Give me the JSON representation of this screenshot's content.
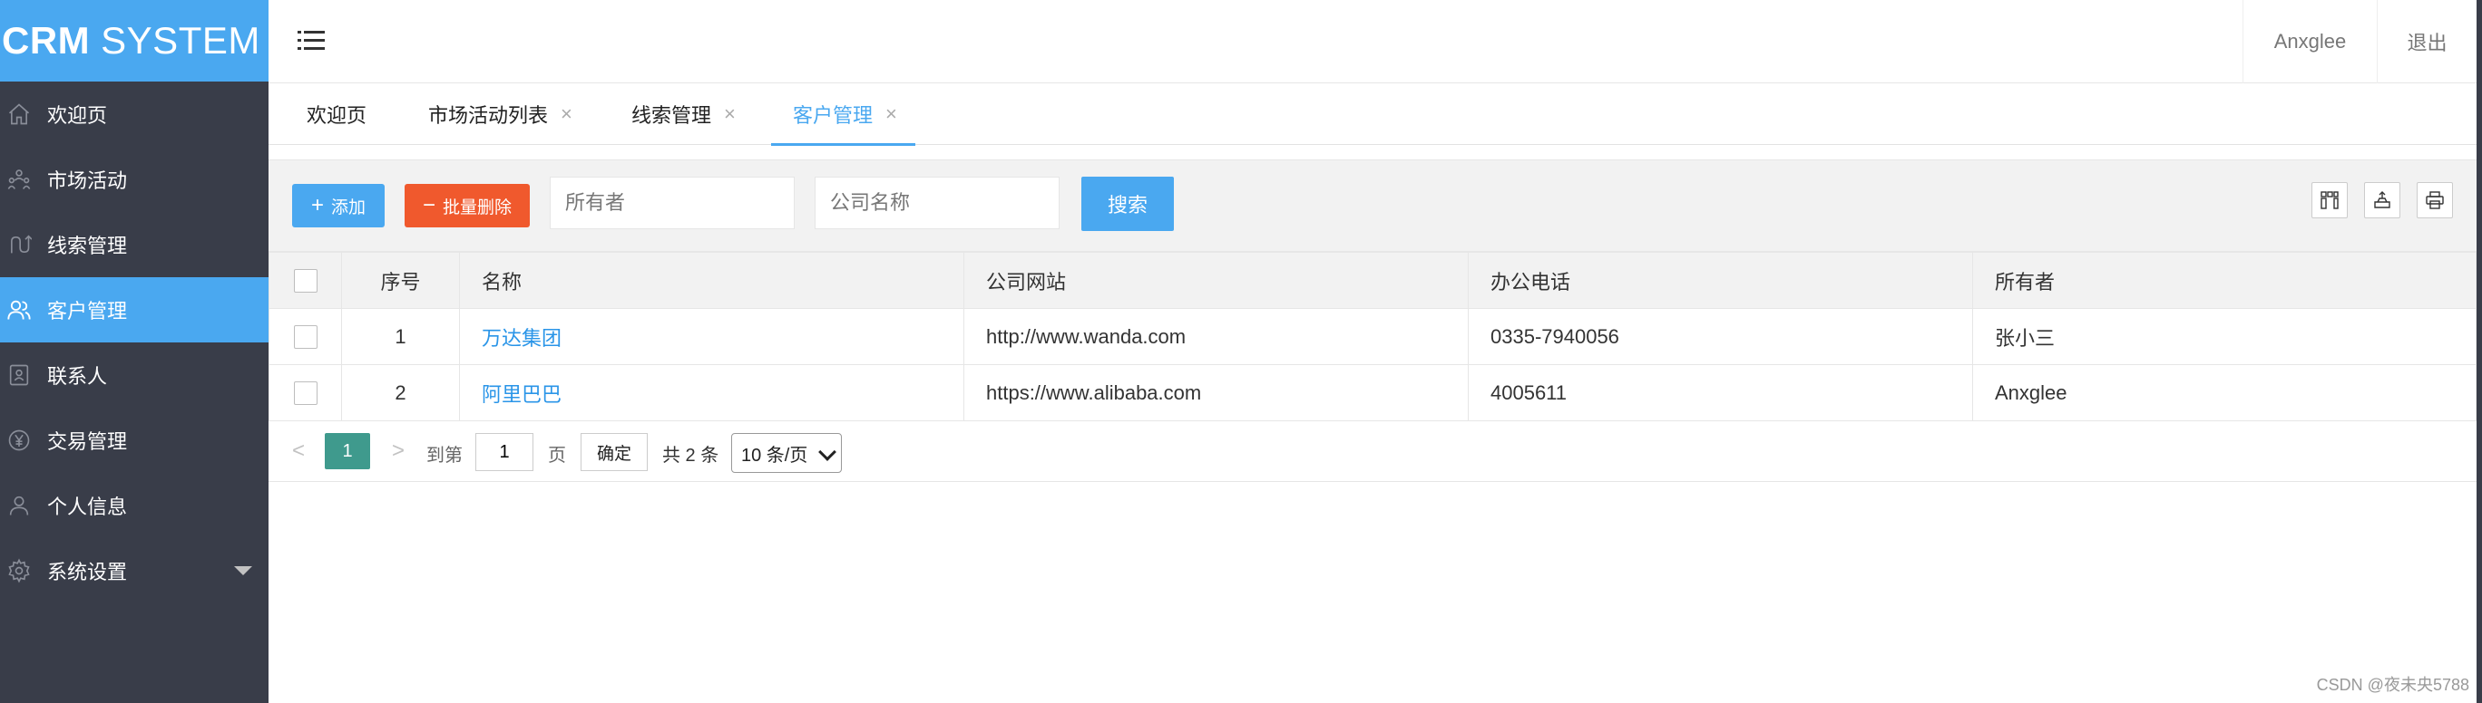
{
  "logo": {
    "part1": "CRM",
    "part2": "SYSTEM"
  },
  "sidebar": {
    "items": [
      {
        "label": "欢迎页",
        "icon": "home-icon"
      },
      {
        "label": "市场活动",
        "icon": "users-group-icon"
      },
      {
        "label": "线索管理",
        "icon": "route-icon"
      },
      {
        "label": "客户管理",
        "icon": "users-icon",
        "active": true
      },
      {
        "label": "联系人",
        "icon": "contact-card-icon"
      },
      {
        "label": "交易管理",
        "icon": "yen-coin-icon"
      },
      {
        "label": "个人信息",
        "icon": "user-icon"
      },
      {
        "label": "系统设置",
        "icon": "gear-icon"
      }
    ]
  },
  "header": {
    "username": "Anxglee",
    "logout": "退出"
  },
  "tabs": [
    {
      "label": "欢迎页"
    },
    {
      "label": "市场活动列表",
      "close": "×"
    },
    {
      "label": "线索管理",
      "close": "×"
    },
    {
      "label": "客户管理",
      "close": "×",
      "active": true
    }
  ],
  "toolbar": {
    "add_label": "添加",
    "batch_delete_label": "批量删除",
    "owner_placeholder": "所有者",
    "company_placeholder": "公司名称",
    "search_label": "搜索"
  },
  "table": {
    "columns": [
      "序号",
      "名称",
      "公司网站",
      "办公电话",
      "所有者"
    ],
    "rows": [
      {
        "index": "1",
        "name": "万达集团",
        "website": "http://www.wanda.com",
        "phone": "0335-7940056",
        "owner": "张小三"
      },
      {
        "index": "2",
        "name": "阿里巴巴",
        "website": "https://www.alibaba.com",
        "phone": "4005611",
        "owner": "Anxglee"
      }
    ]
  },
  "pagination": {
    "prev": "<",
    "next": ">",
    "current_page": "1",
    "goto_label": "到第",
    "goto_value": "1",
    "page_unit": "页",
    "confirm": "确定",
    "total": "共 2 条",
    "page_size": "10 条/页"
  },
  "watermark": "CSDN @夜未央5788",
  "colors": {
    "sidebar_bg": "#393d49",
    "accent": "#4aa8f0",
    "danger": "#f0592d",
    "page_active": "#3f9a8d",
    "link": "#2a95e8"
  }
}
